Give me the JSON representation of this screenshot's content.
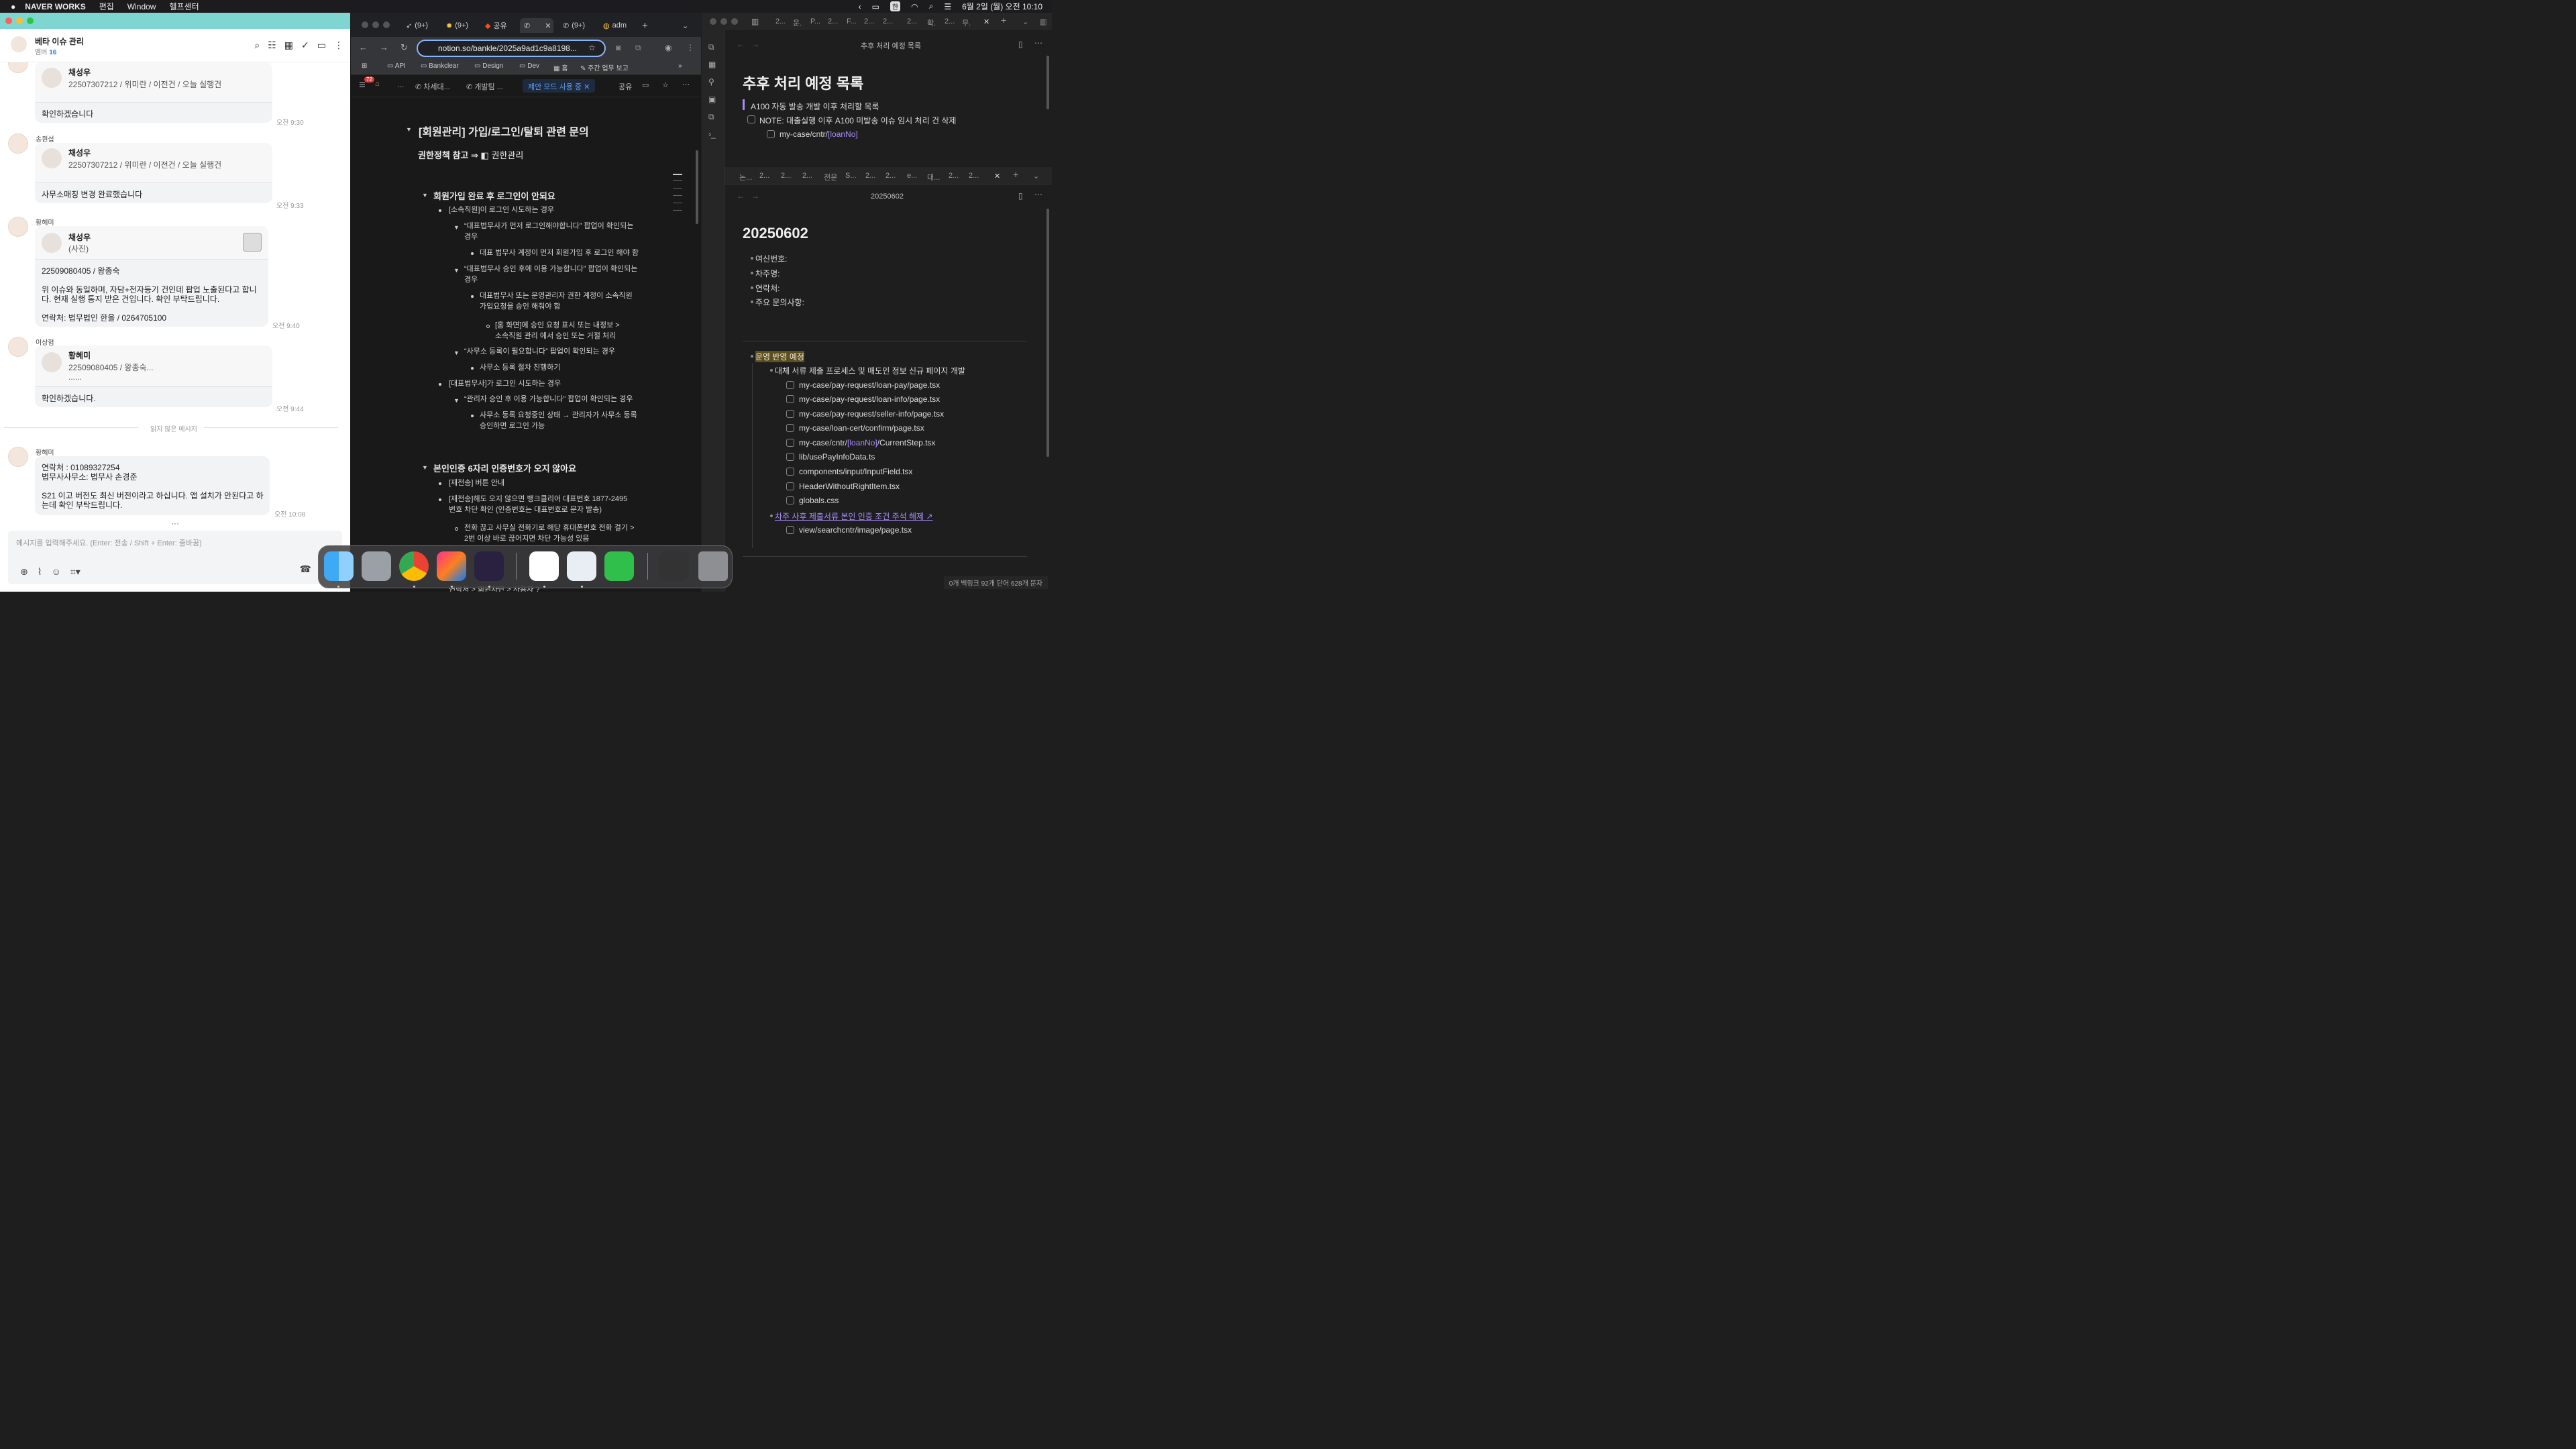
{
  "menubar": {
    "app": "NAVER WORKS",
    "items": [
      "편집",
      "Window",
      "헬프센터"
    ],
    "ime": "한",
    "clock": "6월 2일 (월) 오전 10:10"
  },
  "chat": {
    "title": "베타 이슈 관리",
    "member_label": "멤버",
    "member_count": "16",
    "messages": [
      {
        "q_name": "채성우",
        "q_sub": "22507307212 / 위미란 / 이전건 / 오늘 실행건",
        "text": "확인하겠습니다",
        "time": "오전 9:30"
      },
      {
        "sender": "송원섭",
        "q_name": "채성우",
        "q_sub": "22507307212 / 위미란 / 이전건 / 오늘 실행건",
        "text": "사무소매칭 변경 완료했습니다",
        "time": "오전 9:33"
      },
      {
        "sender": "황혜미",
        "q_name": "채성우",
        "q_sub": "(사진)",
        "text": "22509080405 / 왕종숙\n\n위 이슈와 동일하며, 자담+전자등기 건인데 팝업 노출된다고 합니다. 현재 실행 통지 받은 건입니다. 확인 부탁드립니다.\n\n연락처: 법무법인 한올 / 0264705100",
        "time": "오전 9:40"
      },
      {
        "sender": "이상협",
        "q_name": "황혜미",
        "q_sub": "22509080405 / 왕종숙...",
        "q_sub2": "......",
        "text": "확인하겠습니다.",
        "time": "오전 9:44"
      },
      {
        "sender": "황혜미",
        "text": "연락처 : 01089327254\n법무사사무소: 법무사 손경준\n\nS21 이고 버전도 최신 버전이라고 하십니다. 앱 설치가 안된다고 하는데 확인 부탁드립니다.",
        "time": "오전 10:08"
      }
    ],
    "unread": "읽지 않은 메시지",
    "composer_placeholder": "메시지를 입력해주세요. (Enter: 전송 / Shift + Enter: 줄바꿈)"
  },
  "browser": {
    "tabs": [
      "(9+)",
      "(9+)",
      "공유",
      "",
      "(9+)",
      "adm"
    ],
    "url": "notion.so/bankle/2025a9ad1c9a8198...",
    "bookmarks": [
      "API",
      "Bankclear",
      "Design",
      "Dev",
      "홈",
      "주간 업무 보고"
    ],
    "notion_badge": "72",
    "crumbs": [
      "...",
      "차세대...",
      "개발팀 ..."
    ],
    "suggest": "제안 모드 사용 중",
    "share": "공유",
    "content": {
      "h1": "[회원관리] 가입/로그인/탈퇴 관련 문의",
      "ref": "권한정책 참고 ⇒",
      "ref_link": "권한관리",
      "h2a": "회원가입 완료 후 로그인이 안되요",
      "a1": "[소속직원]이 로그인 시도하는 경우",
      "a2": "“대표법무사가 먼저 로그인해야합니다” 팝업이 확인되는\n경우",
      "a3": "대표 법무사 계정이 먼저 회원가입 후 로그인 해야 함",
      "a4": "“대표법무사 승인 후에 이용 가능합니다” 팝업이 확인되는\n경우",
      "a5": "대표법무사 또는 운영관리자 권한 계정이 소속직원\n가입요청을 승인 해줘야 함",
      "a6": "[홈 화면]에 승인 요청 표시 또는 내정보 >\n소속직원 관리 에서 승인 또는 거절 처리",
      "a7": "“사무소 등록이 필요합니다” 팝업이 확인되는 경우",
      "a8": "사무소 등록 절차 진행하기",
      "a9": "[대표법무사]가 로그인 시도하는 경우",
      "a10": "“관리자 승인 후 이용 가능합니다” 팝업이 확인되는 경우",
      "a11": "사무소 등록 요청중인 상태 → 관리자가 사무소 등록\n승인하면 로그인 가능",
      "h2b": "본인인증 6자리 인증번호가 오지 않아요",
      "b1": "[재전송] 버튼 안내",
      "b2": "[재전송]해도 오지 않으면 뱅크클리어 대표번호 1877-2495\n번호 차단 확인 (인증번호는 대표번호로 문자 발송)",
      "b3": "전화 끊고 사무실 전화기로 해당 휴대폰번호 전화 걸기 >\n2번 이상 바로 끊어지면 차단 가능성 있음",
      "b4": "연락처 > 회원차단 > 사용자 ?"
    }
  },
  "obsidian": {
    "top": {
      "tabs": [
        "2...",
        "운.",
        "P...",
        "2...",
        "F...",
        "2...",
        "2...",
        "2...",
        "확.",
        "2...",
        "무."
      ],
      "pane_title": "추후 처리 예정 목록",
      "h1": "추후 처리 예정 목록",
      "quote": "A100 자동 발송 개발 이후 처리할 목록",
      "note": "NOTE: 대출실행 이후 A100 미발송 이슈 임시 처리 건 삭제",
      "path_a": "my-case/cntr/",
      "path_b": "[loanNo]"
    },
    "bottom": {
      "tabs": [
        "논...",
        "2...",
        "2...",
        "2...",
        "전문",
        "S...",
        "2...",
        "2...",
        "e...",
        "대...",
        "2...",
        "2..."
      ],
      "pane_title": "20250602",
      "h1": "20250602",
      "fields": [
        "여신번호:",
        "차주명:",
        "연락처:",
        "주요 문의사항:"
      ],
      "section": "운영 반영 예정",
      "sub": "대체 서류 제출 프로세스 및 매도인 정보 신규 페이지 개발",
      "files": [
        "my-case/pay-request/loan-pay/page.tsx",
        "my-case/pay-request/loan-info/page.tsx",
        "my-case/pay-request/seller-info/page.tsx",
        "my-case/loan-cert/confirm/page.tsx",
        "my-case/cntr/",
        "[loanNo]",
        "/CurrentStep.tsx",
        "lib/usePayInfoData.ts",
        "components/input/InputField.tsx",
        "HeaderWithoutRightItem.tsx",
        "globals.css"
      ],
      "link": "차주 사후 제출서류 본인 인증 조건 주석 해제",
      "link_file": "view/searchcntr/image/page.tsx",
      "status": "0개 백링크     92개 단어  628개 문자"
    }
  },
  "colors": {
    "chat_header": "#7fd6d1",
    "accent": "#2a7ae4",
    "notion_suggest": "#5a9df7",
    "obsidian_link": "#a88bfa"
  }
}
